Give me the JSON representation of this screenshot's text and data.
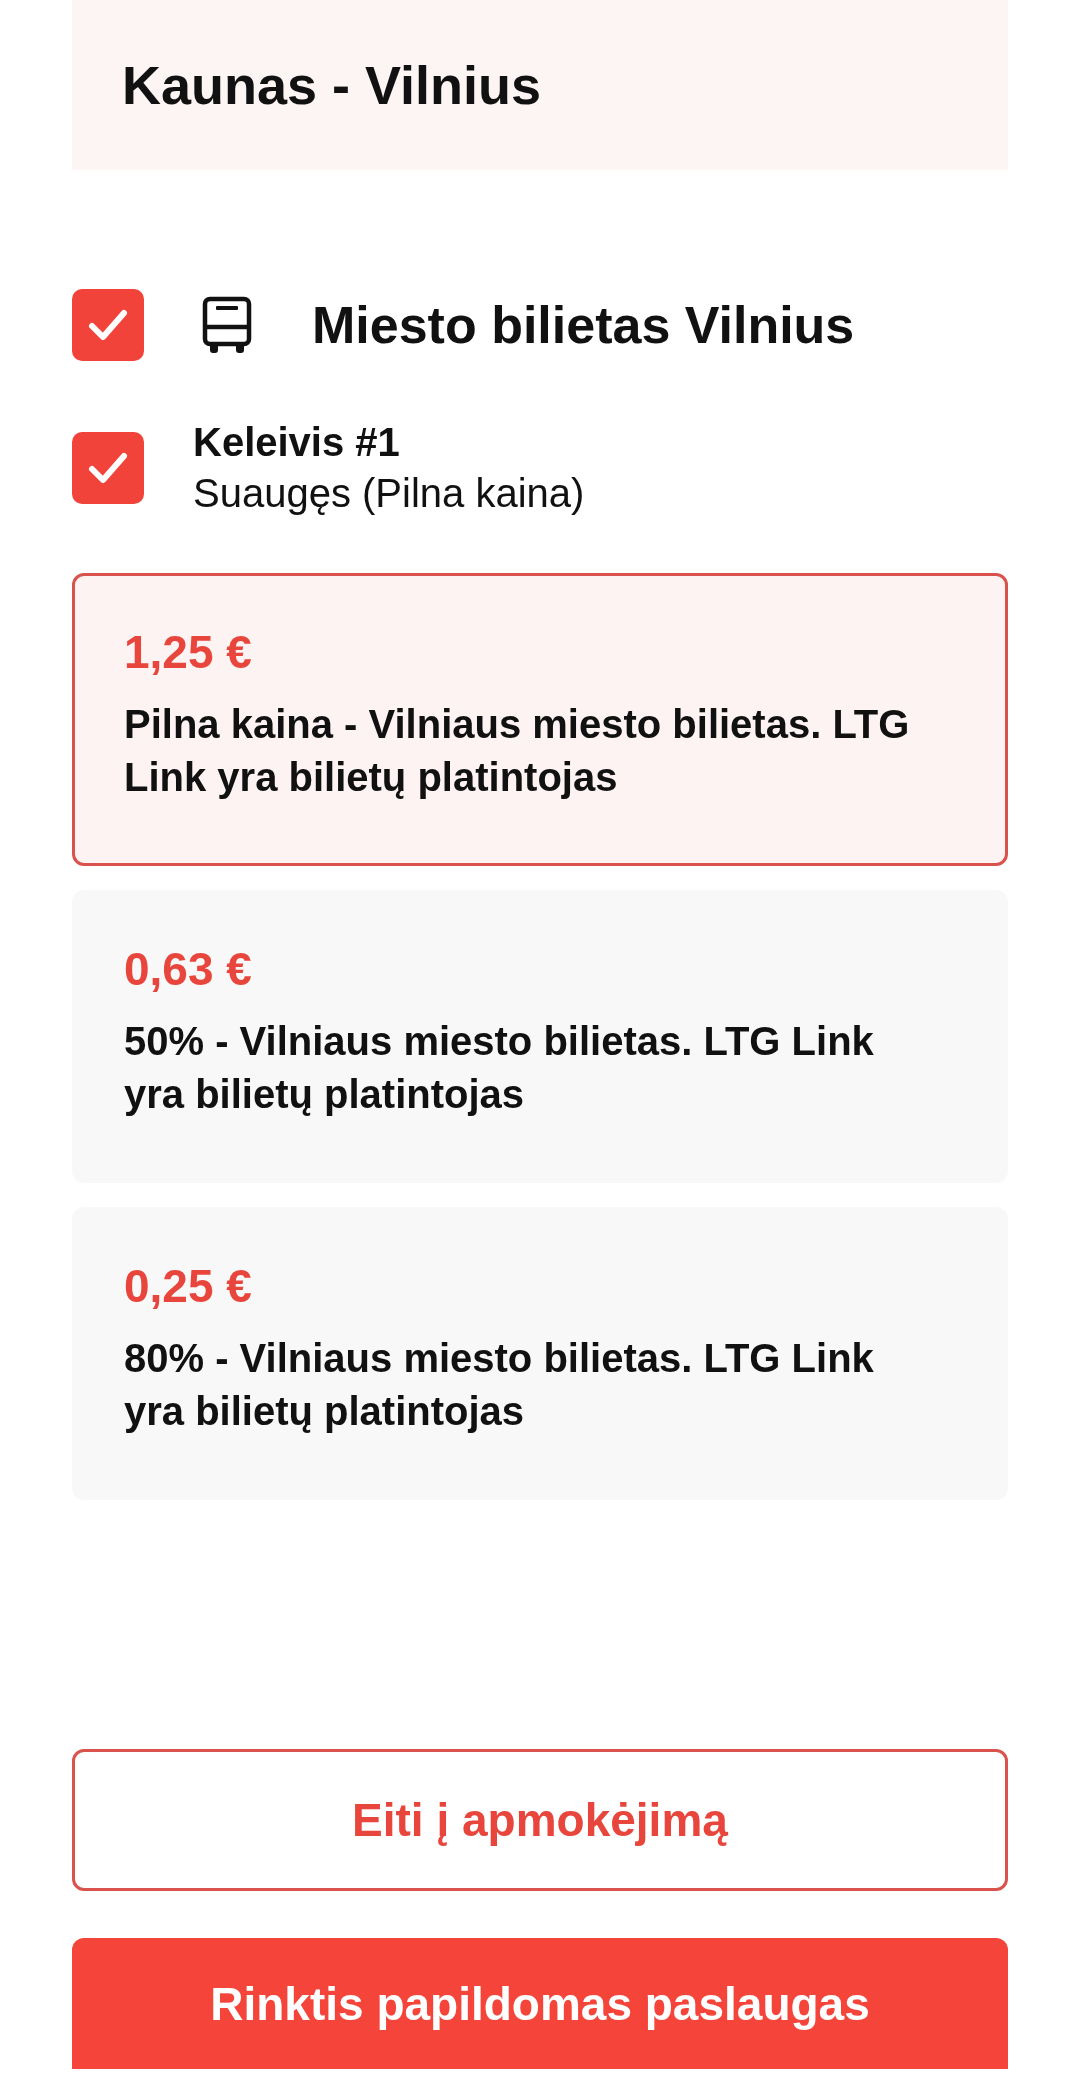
{
  "route": {
    "title": "Kaunas - Vilnius"
  },
  "ticket": {
    "checked": true,
    "title": "Miesto bilietas Vilnius"
  },
  "passenger": {
    "checked": true,
    "name": "Keleivis #1",
    "type": "Suaugęs (Pilna kaina)"
  },
  "fares": [
    {
      "price": "1,25 €",
      "description": "Pilna kaina - Vilniaus miesto bilietas. LTG Link yra bilietų platintojas",
      "selected": true
    },
    {
      "price": "0,63 €",
      "description": "50% - Vilniaus miesto bilietas. LTG Link yra bilietų platintojas",
      "selected": false
    },
    {
      "price": "0,25 €",
      "description": "80% - Vilniaus miesto bilietas. LTG Link yra bilietų platintojas",
      "selected": false
    }
  ],
  "buttons": [
    {
      "label": "Eiti į apmokėjimą",
      "kind": "outline"
    },
    {
      "label": "Rinktis papildomas paslaugas",
      "kind": "primary"
    }
  ]
}
